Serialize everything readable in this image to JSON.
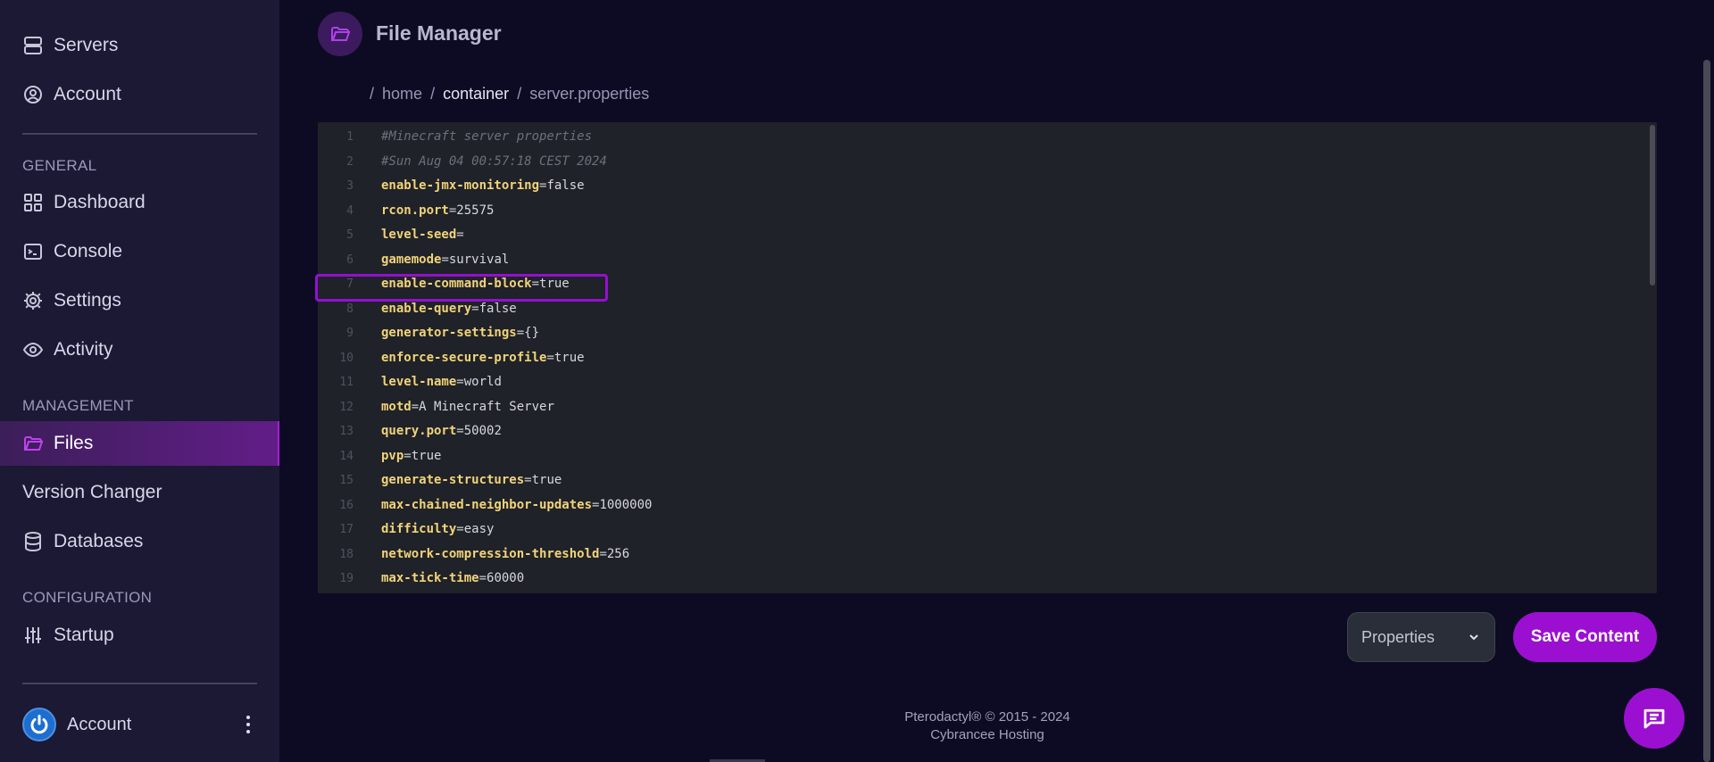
{
  "sidebar": {
    "top_items": [
      {
        "label": "Servers",
        "icon": "server-icon"
      },
      {
        "label": "Account",
        "icon": "user-circle-icon"
      }
    ],
    "sections": {
      "general": "GENERAL",
      "management": "MANAGEMENT",
      "configuration": "CONFIGURATION"
    },
    "general_items": [
      {
        "label": "Dashboard",
        "icon": "grid-icon"
      },
      {
        "label": "Console",
        "icon": "terminal-icon"
      },
      {
        "label": "Settings",
        "icon": "gear-icon"
      },
      {
        "label": "Activity",
        "icon": "eye-icon"
      }
    ],
    "management_items": [
      {
        "label": "Files",
        "icon": "folder-open-icon",
        "active": true
      },
      {
        "label": "Version Changer",
        "icon": ""
      },
      {
        "label": "Databases",
        "icon": "database-icon"
      }
    ],
    "configuration_items": [
      {
        "label": "Startup",
        "icon": "sliders-icon"
      }
    ],
    "account": {
      "name": "Account",
      "avatar_icon": "power-icon"
    }
  },
  "header": {
    "title": "File Manager",
    "icon": "folder-open-icon"
  },
  "breadcrumb": [
    {
      "label": "/",
      "kind": "sep"
    },
    {
      "label": "home",
      "kind": "link"
    },
    {
      "label": "/",
      "kind": "sep"
    },
    {
      "label": "container",
      "kind": "current"
    },
    {
      "label": "/",
      "kind": "sep"
    },
    {
      "label": "server.properties",
      "kind": "link"
    }
  ],
  "editor": {
    "lines": [
      {
        "n": "1",
        "comment": "#Minecraft server properties"
      },
      {
        "n": "2",
        "comment": "#Sun Aug 04 00:57:18 CEST 2024"
      },
      {
        "n": "3",
        "key": "enable-jmx-monitoring",
        "value": "false"
      },
      {
        "n": "4",
        "key": "rcon.port",
        "value": "25575"
      },
      {
        "n": "5",
        "key": "level-seed",
        "value": ""
      },
      {
        "n": "6",
        "key": "gamemode",
        "value": "survival"
      },
      {
        "n": "7",
        "key": "enable-command-block",
        "value": "true"
      },
      {
        "n": "8",
        "key": "enable-query",
        "value": "false"
      },
      {
        "n": "9",
        "key": "generator-settings",
        "value": "{}"
      },
      {
        "n": "10",
        "key": "enforce-secure-profile",
        "value": "true"
      },
      {
        "n": "11",
        "key": "level-name",
        "value": "world"
      },
      {
        "n": "12",
        "key": "motd",
        "value": "A Minecraft Server"
      },
      {
        "n": "13",
        "key": "query.port",
        "value": "50002"
      },
      {
        "n": "14",
        "key": "pvp",
        "value": "true"
      },
      {
        "n": "15",
        "key": "generate-structures",
        "value": "true"
      },
      {
        "n": "16",
        "key": "max-chained-neighbor-updates",
        "value": "1000000"
      },
      {
        "n": "17",
        "key": "difficulty",
        "value": "easy"
      },
      {
        "n": "18",
        "key": "network-compression-threshold",
        "value": "256"
      },
      {
        "n": "19",
        "key": "max-tick-time",
        "value": "60000"
      }
    ],
    "highlighted_line": "7"
  },
  "actions": {
    "language_select": "Properties",
    "save_label": "Save Content"
  },
  "footer": {
    "line1": "Pterodactyl® © 2015 - 2024",
    "line2": "Cybrancee Hosting"
  },
  "colors": {
    "accent": "#9b10d0",
    "sidebar_bg": "#1b1933",
    "page_bg": "#0d0b23",
    "editor_bg": "#1f2228",
    "key": "#f2d37a"
  }
}
